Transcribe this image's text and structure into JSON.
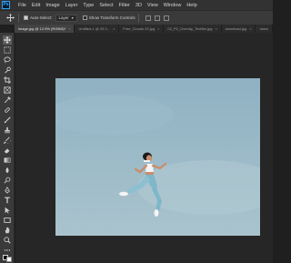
{
  "app": {
    "logo_text": "Ps"
  },
  "menu": [
    "File",
    "Edit",
    "Image",
    "Layer",
    "Type",
    "Select",
    "Filter",
    "3D",
    "View",
    "Window",
    "Help"
  ],
  "options": {
    "auto_select_label": "Auto-Select:",
    "auto_select_checked": true,
    "layer_select_value": "Layer",
    "transform_label": "Show Transform Controls",
    "transform_checked": false
  },
  "tabs": [
    {
      "label": "image.jpg @ 12.5% (RGB/8)*",
      "active": true
    },
    {
      "label": "Untitled-1 @ 33.3...",
      "active": false
    },
    {
      "label": "Free_Clouds 02.jpg",
      "active": false
    },
    {
      "label": "02_P2_Overlay_Textfire.jpg",
      "active": false
    },
    {
      "label": "download.jpg",
      "active": false
    },
    {
      "label": "down",
      "active": false
    }
  ],
  "tools": [
    "move-tool-icon",
    "artboard-icon",
    "marquee-icon",
    "lasso-icon",
    "quick-select-icon",
    "crop-icon",
    "frame-icon",
    "eyedropper-icon",
    "healing-icon",
    "brush-icon",
    "clone-stamp-icon",
    "history-brush-icon",
    "eraser-icon",
    "gradient-icon",
    "blur-icon",
    "dodge-icon",
    "pen-icon",
    "type-icon",
    "path-select-icon",
    "rectangle-icon",
    "hand-icon",
    "zoom-icon",
    "more-tools-icon",
    "color-swatches-icon",
    "quick-mask-icon"
  ],
  "colors": {
    "app_bg": "#262626",
    "panel": "#3a3a3a",
    "accent": "#31a8ff",
    "sky_top": "#8fb1c2",
    "sky_bottom": "#a9c3cd"
  }
}
